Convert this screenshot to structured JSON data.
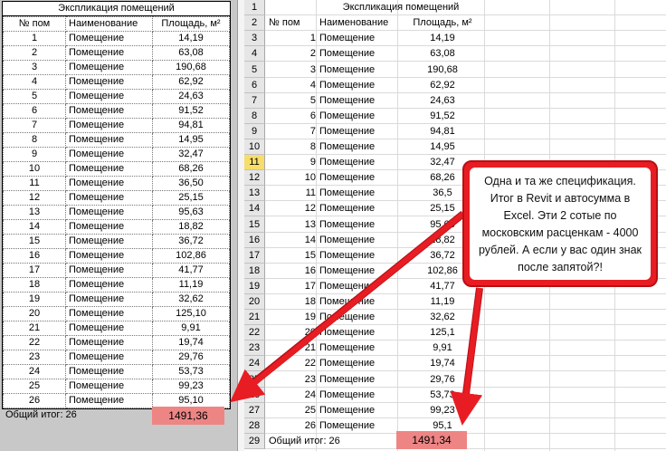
{
  "revit": {
    "title": "Экспликация помещений",
    "headers": [
      "№ пом",
      "Наименование",
      "Площадь, м²"
    ],
    "rows": [
      [
        "1",
        "Помещение",
        "14,19"
      ],
      [
        "2",
        "Помещение",
        "63,08"
      ],
      [
        "3",
        "Помещение",
        "190,68"
      ],
      [
        "4",
        "Помещение",
        "62,92"
      ],
      [
        "5",
        "Помещение",
        "24,63"
      ],
      [
        "6",
        "Помещение",
        "91,52"
      ],
      [
        "7",
        "Помещение",
        "94,81"
      ],
      [
        "8",
        "Помещение",
        "14,95"
      ],
      [
        "9",
        "Помещение",
        "32,47"
      ],
      [
        "10",
        "Помещение",
        "68,26"
      ],
      [
        "11",
        "Помещение",
        "36,50"
      ],
      [
        "12",
        "Помещение",
        "25,15"
      ],
      [
        "13",
        "Помещение",
        "95,63"
      ],
      [
        "14",
        "Помещение",
        "18,82"
      ],
      [
        "15",
        "Помещение",
        "36,72"
      ],
      [
        "16",
        "Помещение",
        "102,86"
      ],
      [
        "17",
        "Помещение",
        "41,77"
      ],
      [
        "18",
        "Помещение",
        "11,19"
      ],
      [
        "19",
        "Помещение",
        "32,62"
      ],
      [
        "20",
        "Помещение",
        "125,10"
      ],
      [
        "21",
        "Помещение",
        "9,91"
      ],
      [
        "22",
        "Помещение",
        "19,74"
      ],
      [
        "23",
        "Помещение",
        "29,76"
      ],
      [
        "24",
        "Помещение",
        "53,73"
      ],
      [
        "25",
        "Помещение",
        "99,23"
      ],
      [
        "26",
        "Помещение",
        "95,10"
      ]
    ],
    "total_label": "Общий итог: 26",
    "total_value": "1491,36"
  },
  "excel": {
    "title": "Экспликация помещений",
    "headers": [
      "№ пом",
      "Наименование",
      "Площадь, м²"
    ],
    "row_numbers": [
      "1",
      "2",
      "3",
      "4",
      "5",
      "6",
      "7",
      "8",
      "9",
      "10",
      "11",
      "12",
      "13",
      "14",
      "15",
      "16",
      "17",
      "18",
      "19",
      "20",
      "21",
      "22",
      "23",
      "24",
      "25",
      "26",
      "27",
      "28",
      "29"
    ],
    "selected_row": "11",
    "rows": [
      [
        "1",
        "Помещение",
        "14,19"
      ],
      [
        "2",
        "Помещение",
        "63,08"
      ],
      [
        "3",
        "Помещение",
        "190,68"
      ],
      [
        "4",
        "Помещение",
        "62,92"
      ],
      [
        "5",
        "Помещение",
        "24,63"
      ],
      [
        "6",
        "Помещение",
        "91,52"
      ],
      [
        "7",
        "Помещение",
        "94,81"
      ],
      [
        "8",
        "Помещение",
        "14,95"
      ],
      [
        "9",
        "Помещение",
        "32,47"
      ],
      [
        "10",
        "Помещение",
        "68,26"
      ],
      [
        "11",
        "Помещение",
        "36,5"
      ],
      [
        "12",
        "Помещение",
        "25,15"
      ],
      [
        "13",
        "Помещение",
        "95,63"
      ],
      [
        "14",
        "Помещение",
        "18,82"
      ],
      [
        "15",
        "Помещение",
        "36,72"
      ],
      [
        "16",
        "Помещение",
        "102,86"
      ],
      [
        "17",
        "Помещение",
        "41,77"
      ],
      [
        "18",
        "Помещение",
        "11,19"
      ],
      [
        "19",
        "Помещение",
        "32,62"
      ],
      [
        "20",
        "Помещение",
        "125,1"
      ],
      [
        "21",
        "Помещение",
        "9,91"
      ],
      [
        "22",
        "Помещение",
        "19,74"
      ],
      [
        "23",
        "Помещение",
        "29,76"
      ],
      [
        "24",
        "Помещение",
        "53,73"
      ],
      [
        "25",
        "Помещение",
        "99,23"
      ],
      [
        "26",
        "Помещение",
        "95,1"
      ]
    ],
    "total_label": "Общий итог: 26",
    "total_value": "1491,34"
  },
  "callout": {
    "text": "Одна и та же спецификация. Итог в Revit и автосумма в Excel. Эти 2 сотые по московским расценкам - 4000 рублей. А если у вас один знак после запятой?!"
  },
  "colors": {
    "highlight": "#ee8585",
    "callout_red": "#e81d23",
    "selected_row_header": "#f7dd6a"
  }
}
